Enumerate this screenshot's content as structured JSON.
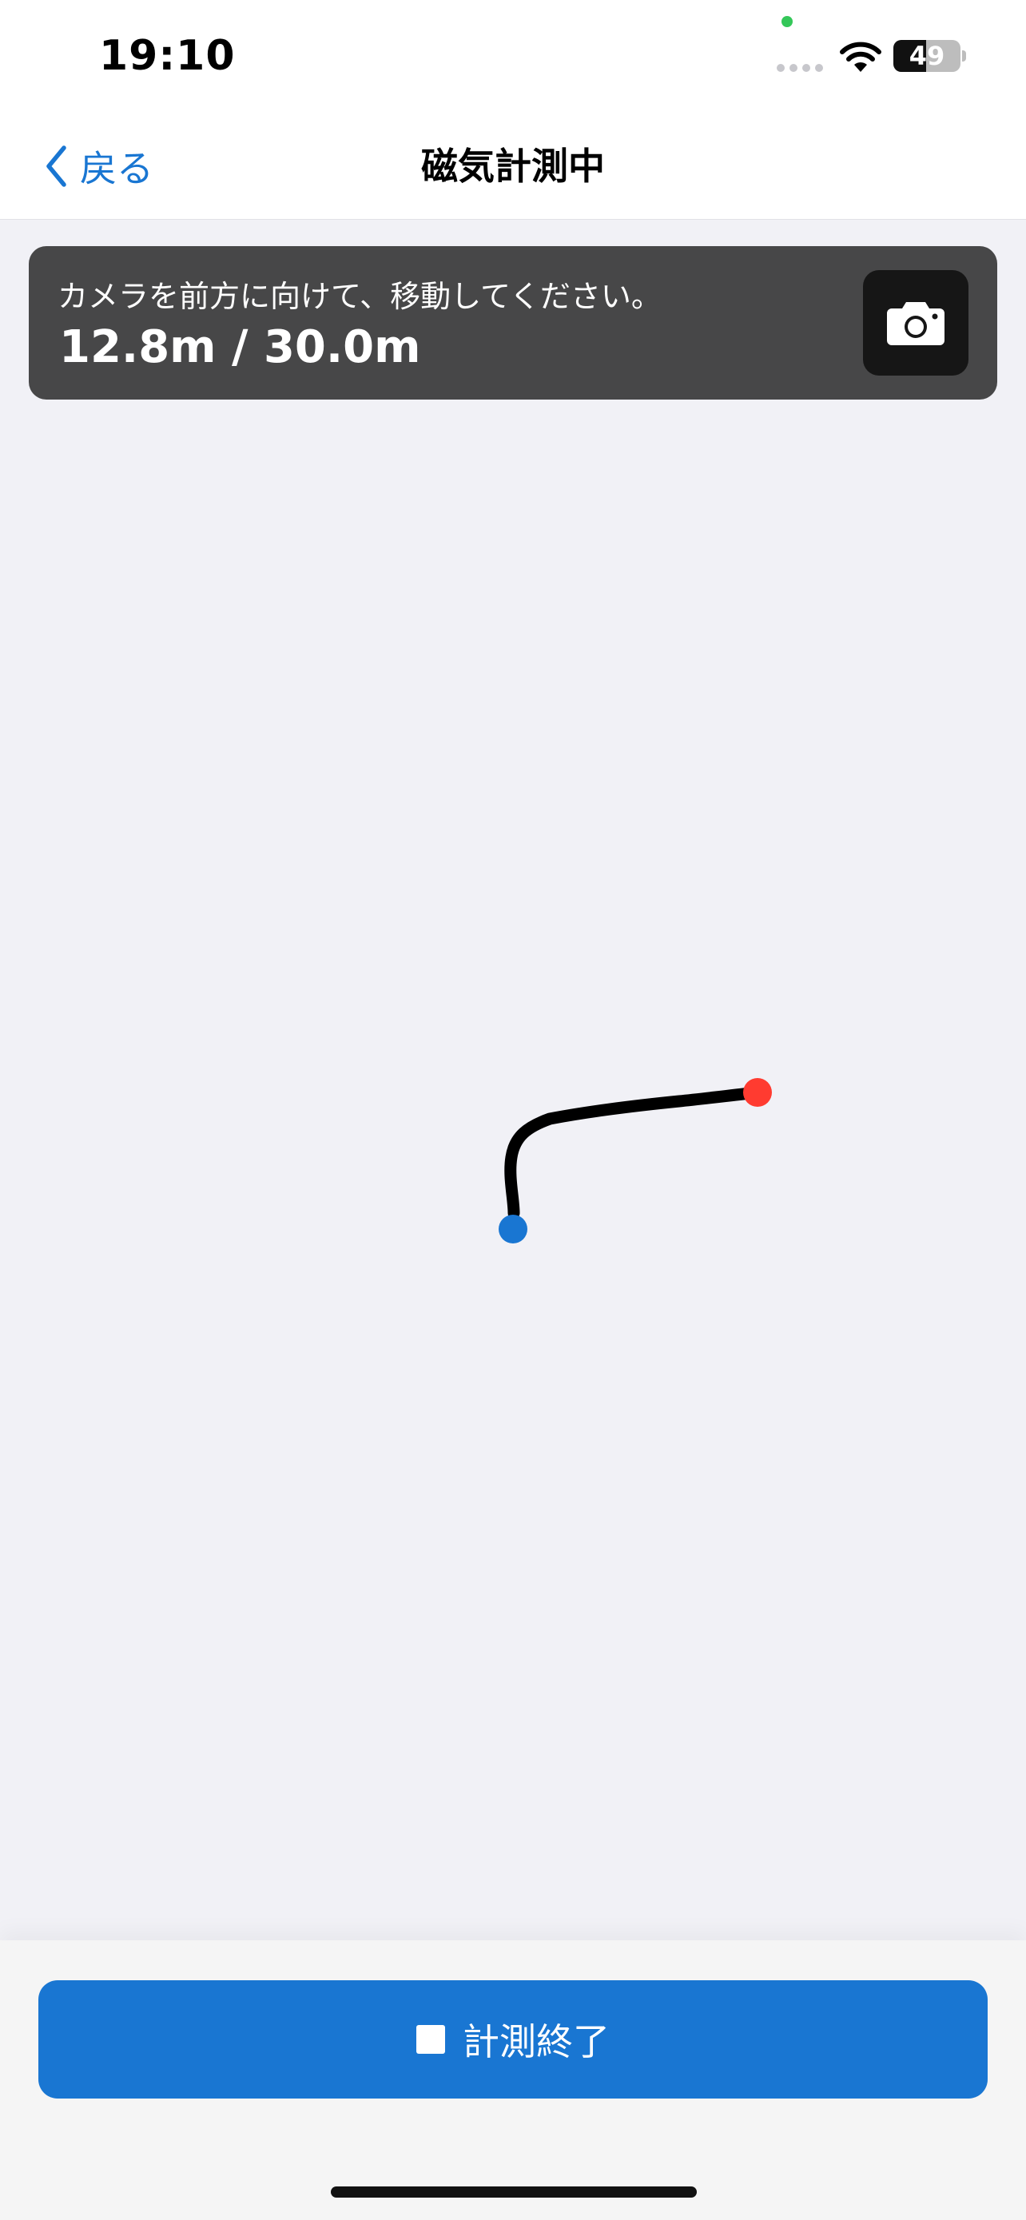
{
  "status_bar": {
    "time": "19:10",
    "battery_percent": 49,
    "battery_text": "49"
  },
  "nav": {
    "back_label": "戻る",
    "title": "磁気計測中"
  },
  "info": {
    "message": "カメラを前方に向けて、移動してください。",
    "distance": "12.8m / 30.0m",
    "current_m": 12.8,
    "target_m": 30.0
  },
  "colors": {
    "accent": "#1976d2",
    "start_point": "#1976d2",
    "end_point": "#ff3b30",
    "path": "#000000"
  },
  "icons": {
    "back": "chevron-left-icon",
    "camera": "camera-icon",
    "stop": "stop-icon",
    "wifi": "wifi-icon"
  },
  "bottom": {
    "stop_label": "計測終了"
  }
}
